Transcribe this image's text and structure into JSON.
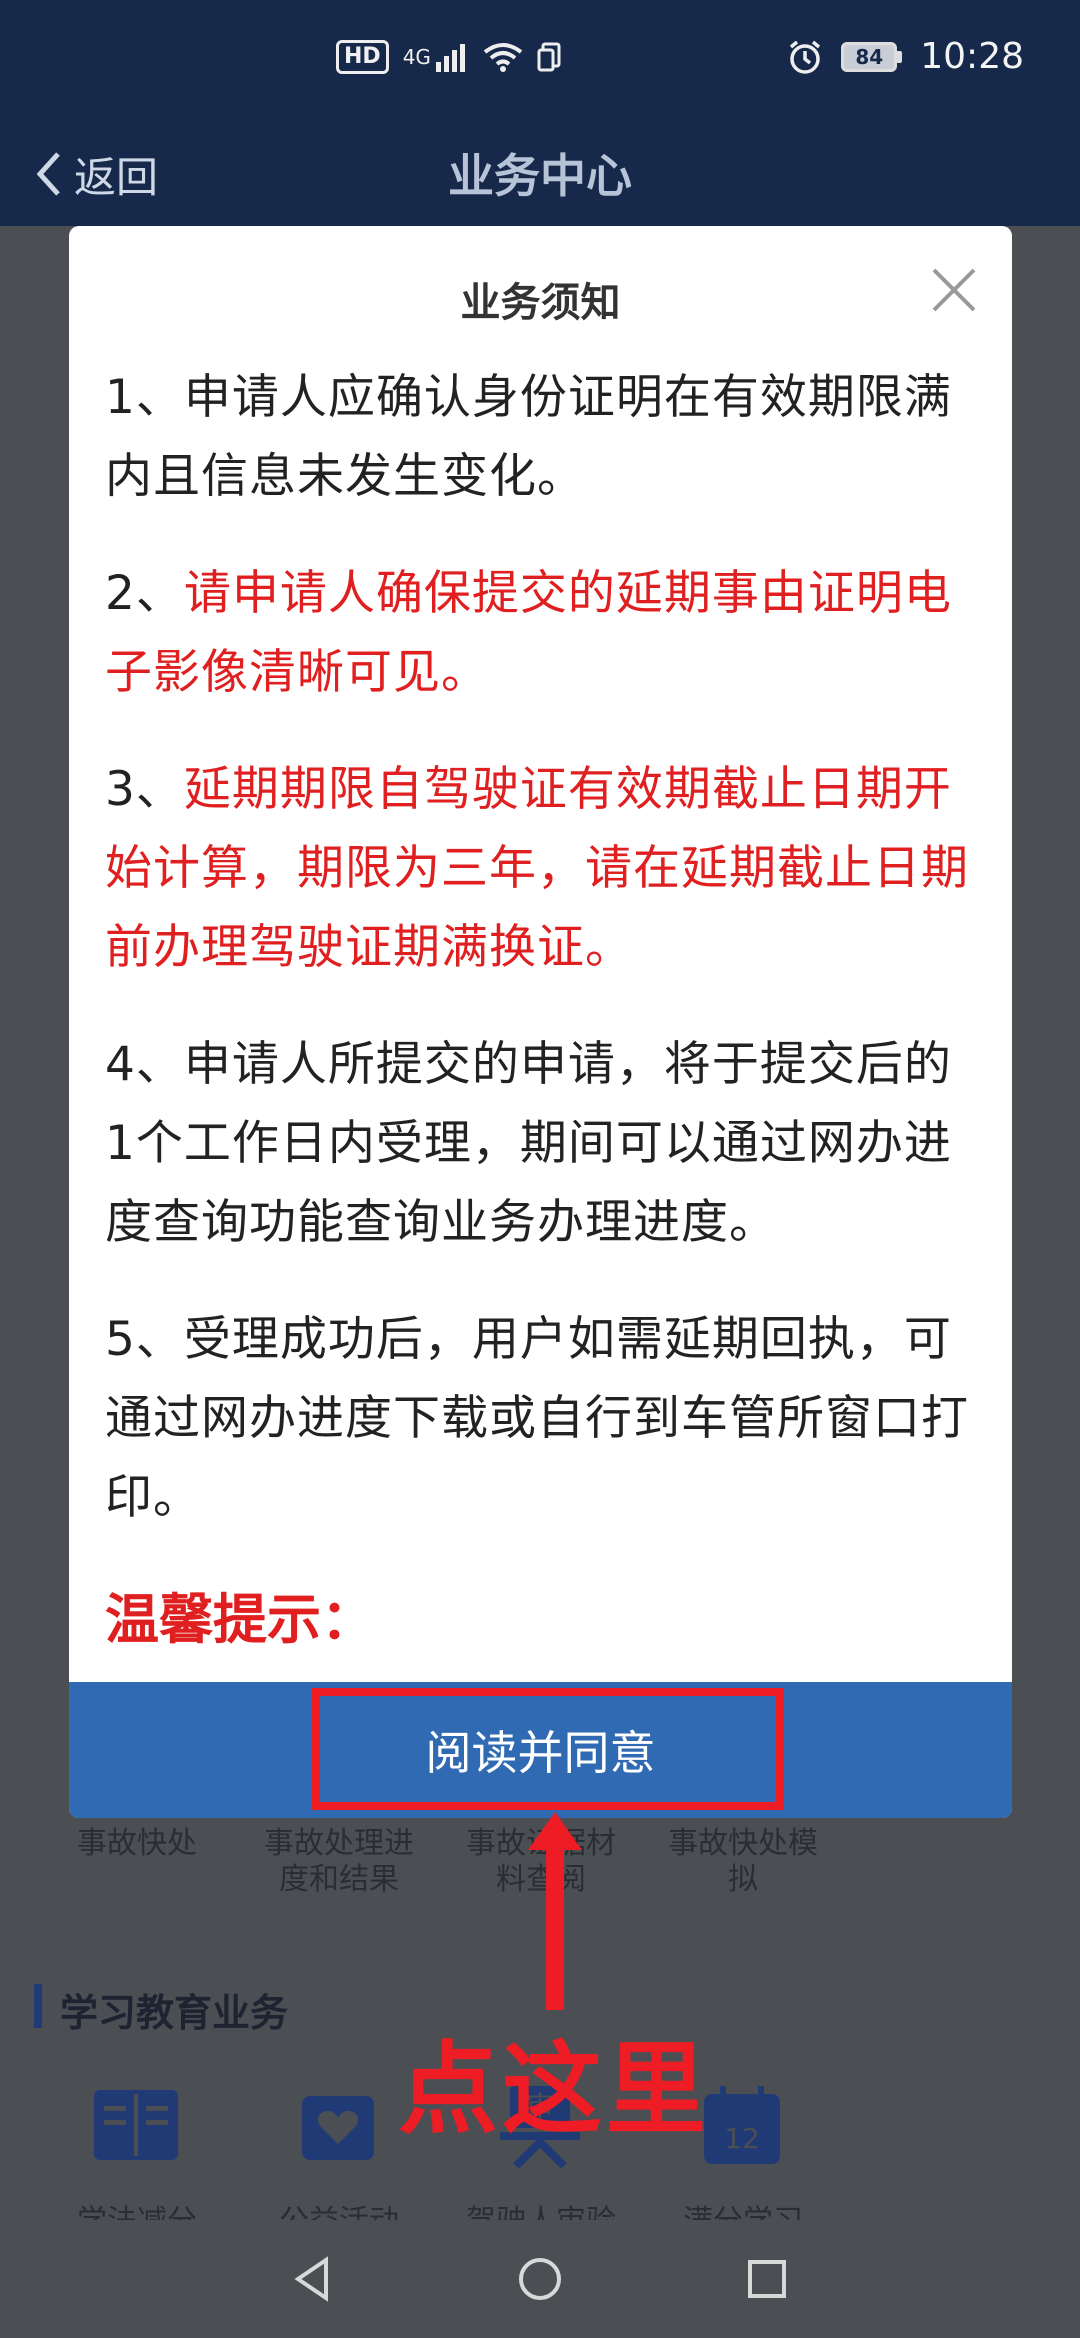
{
  "status_bar": {
    "left_badges": [
      "HD",
      "4G"
    ],
    "battery": "84",
    "time": "10:28"
  },
  "header": {
    "back_label": "返回",
    "title": "业务中心"
  },
  "background": {
    "accident_items": [
      "事故快处",
      "事故处理进度和结果",
      "事故证据材料查阅",
      "事故快处模拟"
    ],
    "study_section_title": "学习教育业务",
    "study_items": [
      "学法减分",
      "公益活动",
      "驾驶人审验",
      "满分学习"
    ],
    "score_icon_number": "12",
    "review_icon_char": "审"
  },
  "modal": {
    "title": "业务须知",
    "paragraphs": {
      "p1": "1、申请人应确认身份证明在有效期限满内且信息未发生变化。",
      "p2_prefix": "2、",
      "p2_red": "请申请人确保提交的延期事由证明电子影像清晰可见。",
      "p3_prefix": "3、",
      "p3_red": "延期期限自驾驶证有效期截止日期开始计算，期限为三年，请在延期截止日期前办理驾驶证期满换证。",
      "p4": "4、申请人所提交的申请，将于提交后的1个工作日内受理，期间可以通过网办进度查询功能查询业务办理进度。",
      "p5": "5、受理成功后，用户如需延期回执，可通过网办进度下载或自行到车管所窗口打印。"
    },
    "tip_label": "温馨提示：",
    "agree_label": "阅读并同意"
  },
  "annotation": {
    "text": "点这里",
    "color": "#ee1c24"
  },
  "colors": {
    "header_bg": "#16294b",
    "primary_button": "#2f6ab3",
    "warning_red": "#e02020"
  }
}
